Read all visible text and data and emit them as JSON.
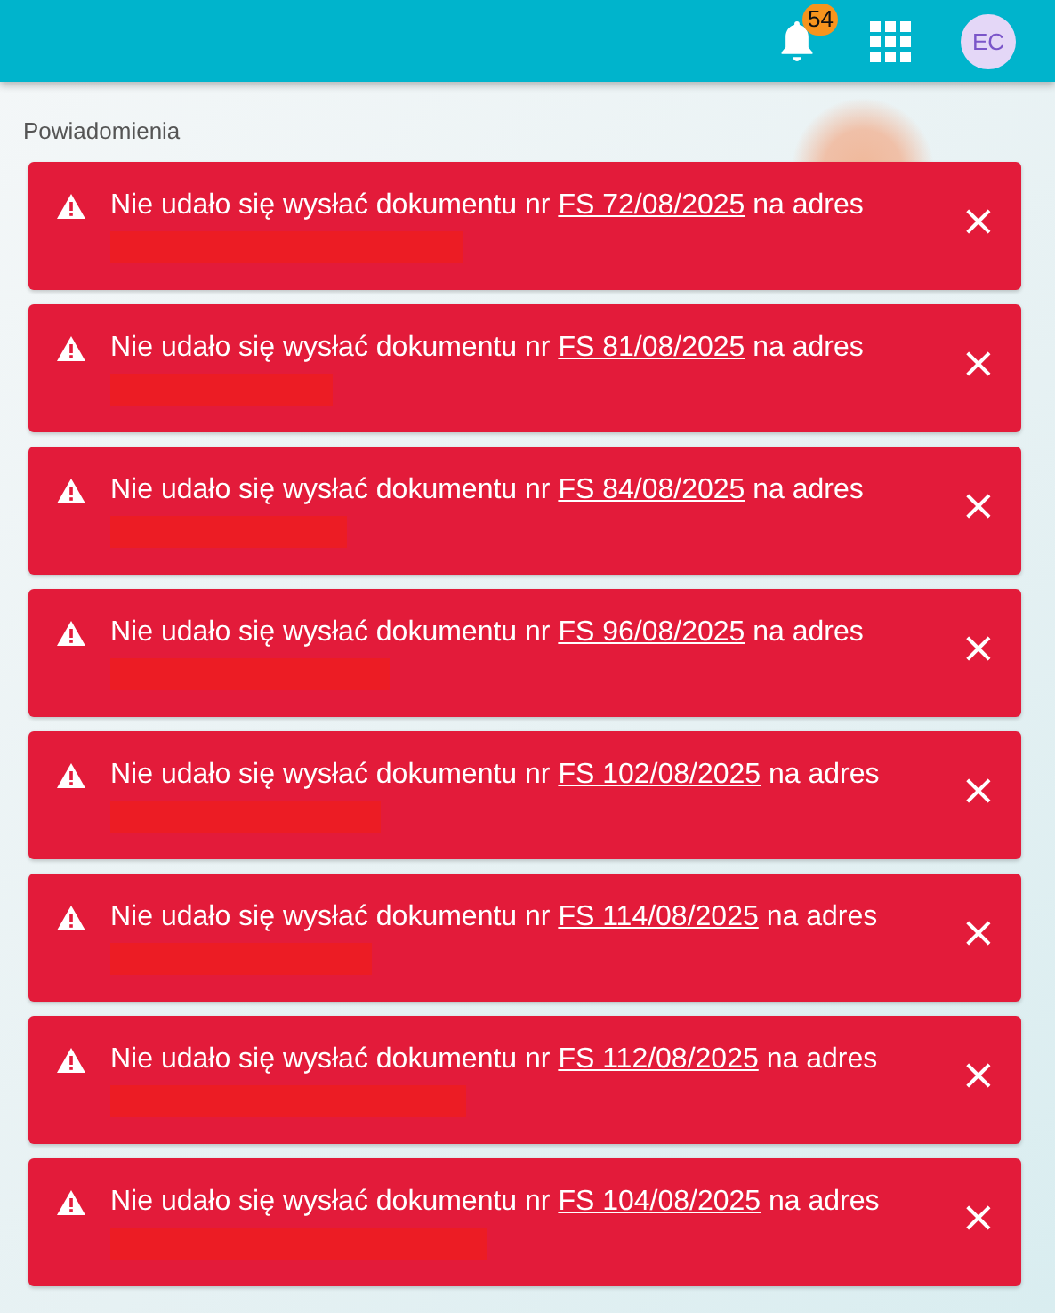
{
  "header": {
    "notifications_count": "54",
    "avatar_initials": "EC"
  },
  "panel": {
    "title": "Powiadomienia"
  },
  "notifications": [
    {
      "text_before": "Nie udało się wysłać dokumentu nr",
      "document": "FS 72/08/2025",
      "text_after": "na adres",
      "close": "×"
    },
    {
      "text_before": "Nie udało się wysłać dokumentu nr",
      "document": "FS 81/08/2025",
      "text_after": "na adres",
      "close": "×"
    },
    {
      "text_before": "Nie udało się wysłać dokumentu nr",
      "document": "FS 84/08/2025",
      "text_after": "na adres",
      "close": "×"
    },
    {
      "text_before": "Nie udało się wysłać dokumentu nr",
      "document": "FS 96/08/2025",
      "text_after": "na adres",
      "close": "×"
    },
    {
      "text_before": "Nie udało się wysłać dokumentu nr",
      "document": "FS 102/08/2025",
      "text_after": "na adres",
      "close": "×"
    },
    {
      "text_before": "Nie udało się wysłać dokumentu nr",
      "document": "FS 114/08/2025",
      "text_after": "na adres",
      "close": "×"
    },
    {
      "text_before": "Nie udało się wysłać dokumentu nr",
      "document": "FS 112/08/2025",
      "text_after": "na adres",
      "close": "×"
    },
    {
      "text_before": "Nie udało się wysłać dokumentu nr",
      "document": "FS 104/08/2025",
      "text_after": "na adres",
      "close": "×"
    }
  ]
}
